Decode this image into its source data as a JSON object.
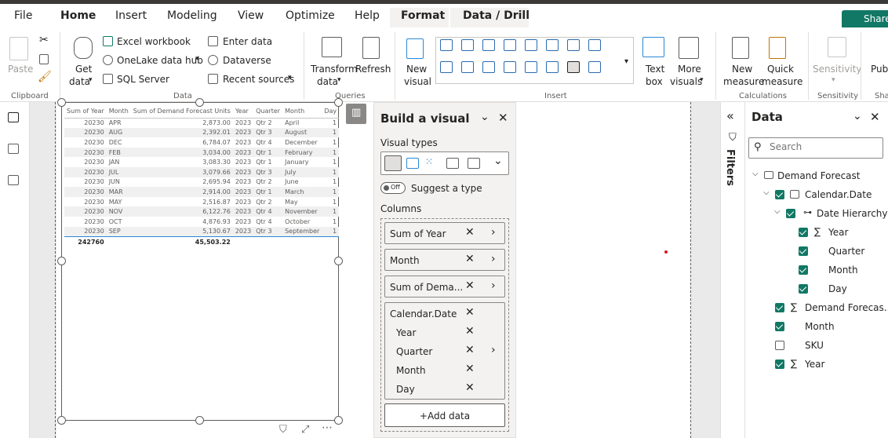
{
  "menu": {
    "items": [
      "File",
      "Home",
      "Insert",
      "Modeling",
      "View",
      "Optimize",
      "Help",
      "Format",
      "Data / Drill"
    ],
    "share_label": "Share"
  },
  "ribbon": {
    "clipboard": {
      "paste": "Paste",
      "label": "Clipboard"
    },
    "data": {
      "get_data": "Get",
      "get_data2": "data",
      "excel": "Excel workbook",
      "onelake": "OneLake data hub",
      "sql": "SQL Server",
      "enter_data": "Enter data",
      "dataverse": "Dataverse",
      "recent": "Recent sources",
      "label": "Data"
    },
    "queries": {
      "transform": "Transform",
      "transform2": "data",
      "refresh": "Refresh",
      "label": "Queries"
    },
    "insert": {
      "new_visual": "New",
      "new_visual2": "visual",
      "text_box": "Text",
      "text_box2": "box",
      "more_visuals": "More",
      "more_visuals2": "visuals",
      "label": "Insert"
    },
    "calculations": {
      "new_measure": "New",
      "new_measure2": "measure",
      "quick_measure": "Quick",
      "quick_measure2": "measure",
      "label": "Calculations"
    },
    "sensitivity": {
      "btn": "Sensitivity",
      "label": "Sensitivity"
    },
    "share": {
      "btn": "Publi",
      "label": "Sha"
    }
  },
  "table": {
    "headers": [
      "Sum of Year",
      "Month",
      "Sum of Demand Forecast Units",
      "Year",
      "Quarter",
      "Month",
      "Day"
    ],
    "rows": [
      [
        "20230",
        "APR",
        "2,873.00",
        "2023",
        "Qtr 2",
        "April",
        "1"
      ],
      [
        "20230",
        "AUG",
        "2,392.01",
        "2023",
        "Qtr 3",
        "August",
        "1"
      ],
      [
        "20230",
        "DEC",
        "6,784.07",
        "2023",
        "Qtr 4",
        "December",
        "1"
      ],
      [
        "20230",
        "FEB",
        "3,034.00",
        "2023",
        "Qtr 1",
        "February",
        "1"
      ],
      [
        "20230",
        "JAN",
        "3,083.30",
        "2023",
        "Qtr 1",
        "January",
        "1"
      ],
      [
        "20230",
        "JUL",
        "3,079.66",
        "2023",
        "Qtr 3",
        "July",
        "1"
      ],
      [
        "20230",
        "JUN",
        "2,695.94",
        "2023",
        "Qtr 2",
        "June",
        "1"
      ],
      [
        "20230",
        "MAR",
        "2,914.00",
        "2023",
        "Qtr 1",
        "March",
        "1"
      ],
      [
        "20230",
        "MAY",
        "2,516.87",
        "2023",
        "Qtr 2",
        "May",
        "1"
      ],
      [
        "20230",
        "NOV",
        "6,122.76",
        "2023",
        "Qtr 4",
        "November",
        "1"
      ],
      [
        "20230",
        "OCT",
        "4,876.93",
        "2023",
        "Qtr 4",
        "October",
        "1"
      ],
      [
        "20230",
        "SEP",
        "5,130.67",
        "2023",
        "Qtr 3",
        "September",
        "1"
      ]
    ],
    "total": [
      "242760",
      "",
      "45,503.22",
      "",
      "",
      "",
      ""
    ]
  },
  "build_visual": {
    "title": "Build a visual",
    "visual_types_label": "Visual types",
    "suggest_toggle": "Off",
    "suggest_label": "Suggest a type",
    "columns_label": "Columns",
    "fields": [
      "Sum of Year",
      "Month",
      "Sum of Dema..."
    ],
    "hierarchy": {
      "name": "Calendar.Date",
      "levels": [
        "Year",
        "Quarter",
        "Month",
        "Day"
      ]
    },
    "add_data": "+Add data"
  },
  "filters": {
    "label": "Filters"
  },
  "data_pane": {
    "title": "Data",
    "search_placeholder": "Search",
    "table_name": "Demand Forecast",
    "calendar": "Calendar.Date",
    "date_hierarchy": "Date Hierarchy",
    "levels": [
      "Year",
      "Quarter",
      "Month",
      "Day"
    ],
    "fields": [
      "Demand Forecas...",
      "Month",
      "SKU",
      "Year"
    ]
  }
}
